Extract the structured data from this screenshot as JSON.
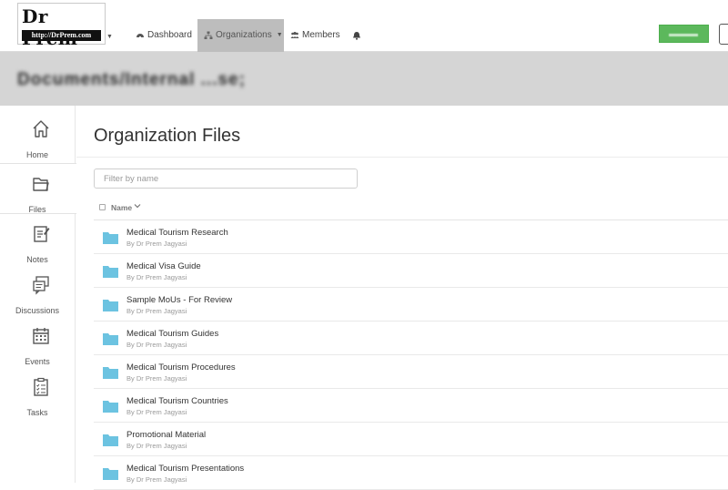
{
  "logo": {
    "title": "Dr Prem",
    "url": "http://DrPrem.com"
  },
  "nav": {
    "dashboard": "Dashboard",
    "organizations": "Organizations",
    "members": "Members"
  },
  "banner": {
    "text": "Documents/Internal ...se;"
  },
  "sidebar": {
    "items": [
      {
        "label": "Home",
        "icon": "home-icon"
      },
      {
        "label": "Files",
        "icon": "files-icon"
      },
      {
        "label": "Notes",
        "icon": "notes-icon"
      },
      {
        "label": "Discussions",
        "icon": "discussions-icon"
      },
      {
        "label": "Events",
        "icon": "events-icon"
      },
      {
        "label": "Tasks",
        "icon": "tasks-icon"
      }
    ]
  },
  "main": {
    "title": "Organization Files",
    "filter_placeholder": "Filter by name",
    "column_name": "Name"
  },
  "files": [
    {
      "name": "Medical Tourism Research",
      "by": "By Dr Prem Jagyasi"
    },
    {
      "name": "Medical Visa Guide",
      "by": "By Dr Prem Jagyasi"
    },
    {
      "name": "Sample MoUs - For Review",
      "by": "By Dr Prem Jagyasi"
    },
    {
      "name": "Medical Tourism Guides",
      "by": "By Dr Prem Jagyasi"
    },
    {
      "name": "Medical Tourism Procedures",
      "by": "By Dr Prem Jagyasi"
    },
    {
      "name": "Medical Tourism Countries",
      "by": "By Dr Prem Jagyasi"
    },
    {
      "name": "Promotional Material",
      "by": "By Dr Prem Jagyasi"
    },
    {
      "name": "Medical Tourism Presentations",
      "by": "By Dr Prem Jagyasi"
    }
  ],
  "colors": {
    "folder": "#6cc3e0",
    "active_nav": "#bdbdbd",
    "green_button": "#5cb85c",
    "banner": "#d5d5d5"
  }
}
